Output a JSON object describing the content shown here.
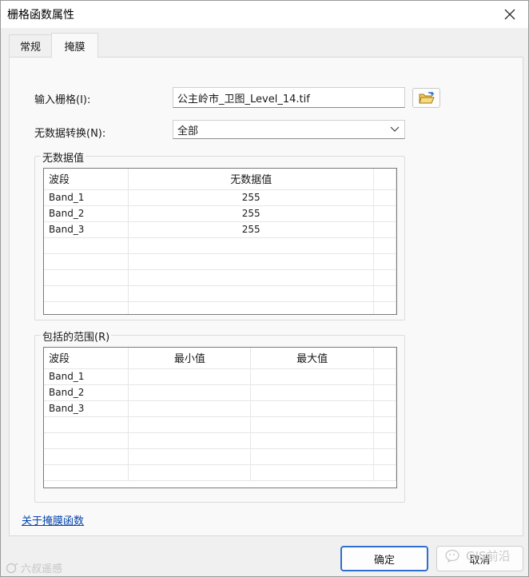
{
  "window": {
    "title": "栅格函数属性"
  },
  "tabs": [
    {
      "label": "常规",
      "active": false
    },
    {
      "label": "掩膜",
      "active": true
    }
  ],
  "form": {
    "input_raster_label": "输入栅格(I):",
    "input_raster_value": "公主岭市_卫图_Level_14.tif",
    "nodata_transform_label": "无数据转换(N):",
    "nodata_transform_value": "全部"
  },
  "nodata_group": {
    "title": "无数据值",
    "columns": [
      "波段",
      "无数据值"
    ],
    "rows": [
      {
        "band": "Band_1",
        "value": "255"
      },
      {
        "band": "Band_2",
        "value": "255"
      },
      {
        "band": "Band_3",
        "value": "255"
      }
    ]
  },
  "range_group": {
    "title": "包括的范围(R)",
    "columns": [
      "波段",
      "最小值",
      "最大值"
    ],
    "rows": [
      {
        "band": "Band_1",
        "min": "",
        "max": ""
      },
      {
        "band": "Band_2",
        "min": "",
        "max": ""
      },
      {
        "band": "Band_3",
        "min": "",
        "max": ""
      }
    ]
  },
  "about_link": "关于掩膜函数",
  "buttons": {
    "ok": "确定",
    "cancel": "取消"
  },
  "watermarks": {
    "left": "六叔遥感",
    "right": "GIS前沿"
  },
  "icons": {
    "close": "close-icon",
    "browse": "folder-open-icon",
    "dropdown": "chevron-down-icon"
  },
  "colors": {
    "link": "#0645ad",
    "ok_border": "#2f6fd1",
    "folder": "#e8b84a"
  }
}
